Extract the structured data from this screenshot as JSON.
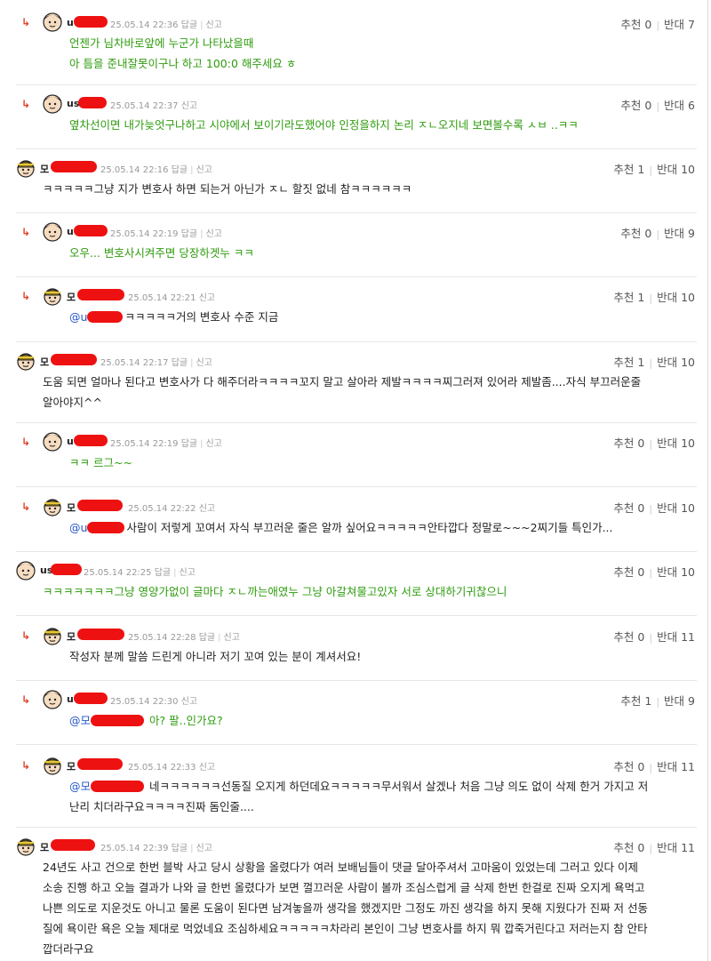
{
  "comments": [
    {
      "name": "u",
      "meta": "25.05.14 22:36",
      "reply_label": "답글",
      "report_label": "신고",
      "up_label": "추천",
      "up": "0",
      "down_label": "반대",
      "down": "7",
      "lines": [
        "언젠가 님차바로앞에 누군가 나타났을때",
        "아 틈을 준내잘못이구나 하고 100:0 해주세요 ㅎ"
      ]
    },
    {
      "name": "us",
      "meta": "25.05.14 22:37",
      "report_label": "신고",
      "up_label": "추천",
      "up": "0",
      "down_label": "반대",
      "down": "6",
      "lines": [
        "옆차선이면 내가늦엇구나하고 시야에서 보이기라도했어야 인정을하지 논리 ㅈㄴ오지네 보면볼수록 ㅅㅂ ..ㅋㅋ"
      ]
    },
    {
      "name": "모",
      "meta": "25.05.14 22:16",
      "reply_label": "답글",
      "report_label": "신고",
      "up_label": "추천",
      "up": "1",
      "down_label": "반대",
      "down": "10",
      "lines": [
        "ㅋㅋㅋㅋㅋ그냥 지가 변호사 하면 되는거 아닌가 ㅈㄴ 할짓 없네 참ㅋㅋㅋㅋㅋㅋ"
      ]
    },
    {
      "name": "u",
      "meta": "25.05.14 22:19",
      "reply_label": "답글",
      "report_label": "신고",
      "up_label": "추천",
      "up": "0",
      "down_label": "반대",
      "down": "9",
      "lines": [
        "오우... 변호사시켜주면 당장하겟누 ㅋㅋ"
      ]
    },
    {
      "name": "모",
      "meta": "25.05.14 22:21",
      "report_label": "신고",
      "up_label": "추천",
      "up": "1",
      "down_label": "반대",
      "down": "10",
      "mention": "@u",
      "lines": [
        "ㅋㅋㅋㅋㅋ거의 변호사 수준 지금"
      ]
    },
    {
      "name": "모",
      "meta": "25.05.14 22:17",
      "reply_label": "답글",
      "report_label": "신고",
      "up_label": "추천",
      "up": "1",
      "down_label": "반대",
      "down": "10",
      "lines": [
        "도움 되면 얼마나 된다고 변호사가 다 해주더라ㅋㅋㅋㅋ꼬지 말고 살아라 제발ㅋㅋㅋㅋ찌그러져 있어라 제발좀....자식 부끄러운줄",
        "알아야지^^"
      ]
    },
    {
      "name": "u",
      "meta": "25.05.14 22:19",
      "reply_label": "답글",
      "report_label": "신고",
      "up_label": "추천",
      "up": "0",
      "down_label": "반대",
      "down": "10",
      "lines": [
        "ㅋㅋ 르그~~"
      ]
    },
    {
      "name": "모",
      "meta": "25.05.14 22:22",
      "report_label": "신고",
      "up_label": "추천",
      "up": "0",
      "down_label": "반대",
      "down": "10",
      "mention": "@u",
      "lines": [
        "사람이 저렇게 꼬여서 자식 부끄러운 줄은 알까 싶어요ㅋㅋㅋㅋㅋ안타깝다 정말로~~~2찌기들 특인가..."
      ]
    },
    {
      "name": "us",
      "meta": "25.05.14 22:25",
      "reply_label": "답글",
      "report_label": "신고",
      "up_label": "추천",
      "up": "0",
      "down_label": "반대",
      "down": "10",
      "lines": [
        "ㅋㅋㅋㅋㅋㅋㅋ그냥 영양가없이 글마다 ㅈㄴ까는애였누 그냥 아갈쳐물고있자 서로 상대하기귀찮으니"
      ]
    },
    {
      "name": "모",
      "meta": "25.05.14 22:28",
      "reply_label": "답글",
      "report_label": "신고",
      "up_label": "추천",
      "up": "0",
      "down_label": "반대",
      "down": "11",
      "lines": [
        "작성자 분께 말씀 드린게 아니라 저기 꼬여 있는 분이 계셔서요!"
      ]
    },
    {
      "name": "u",
      "meta": "25.05.14 22:30",
      "report_label": "신고",
      "up_label": "추천",
      "up": "1",
      "down_label": "반대",
      "down": "9",
      "mention": "@모",
      "lines": [
        " 아? 팔..인가요?"
      ]
    },
    {
      "name": "모",
      "meta": "25.05.14 22:33",
      "report_label": "신고",
      "up_label": "추천",
      "up": "0",
      "down_label": "반대",
      "down": "11",
      "mention": "@모",
      "lines": [
        " 네ㅋㅋㅋㅋㅋㅋ선동질 오지게 하던데요ㅋㅋㅋㅋㅋ무서워서 살겠나 처음 그냥 의도 없이 삭제 한거 가지고 저",
        "난리 치더라구요ㅋㅋㅋㅋ진짜 돔인줄...."
      ]
    },
    {
      "name": "모",
      "meta": "25.05.14 22:39",
      "reply_label": "답글",
      "report_label": "신고",
      "up_label": "추천",
      "up": "0",
      "down_label": "반대",
      "down": "11",
      "lines": [
        "24년도 사고 건으로 한번 블박 사고 당시 상황을 올렸다가 여러 보배님들이 댓글 달아주셔서 고마움이 있었는데 그러고 있다 이제",
        "소송 진행 하고 오늘 결과가 나와 글 한번 올렸다가 보면 껄끄러운 사람이 볼까 조심스럽게 글 삭제 한번 한걸로 진짜 오지게 욕먹고",
        "나쁜 의도로 지운것도 아니고 물론 도움이 된다면 남겨놓을까 생각을 했겠지만 그정도 까진 생각을 하지 못해 지웠다가 진짜 저 선동",
        "질에 욕이란 욕은 오늘 제대로 먹었네요 조심하세요ㅋㅋㅋㅋㅋ차라리 본인이 그냥 변호사를 하지 뭐 깝죽거린다고 저러는지 참 안타",
        "깝더라구요"
      ]
    }
  ]
}
